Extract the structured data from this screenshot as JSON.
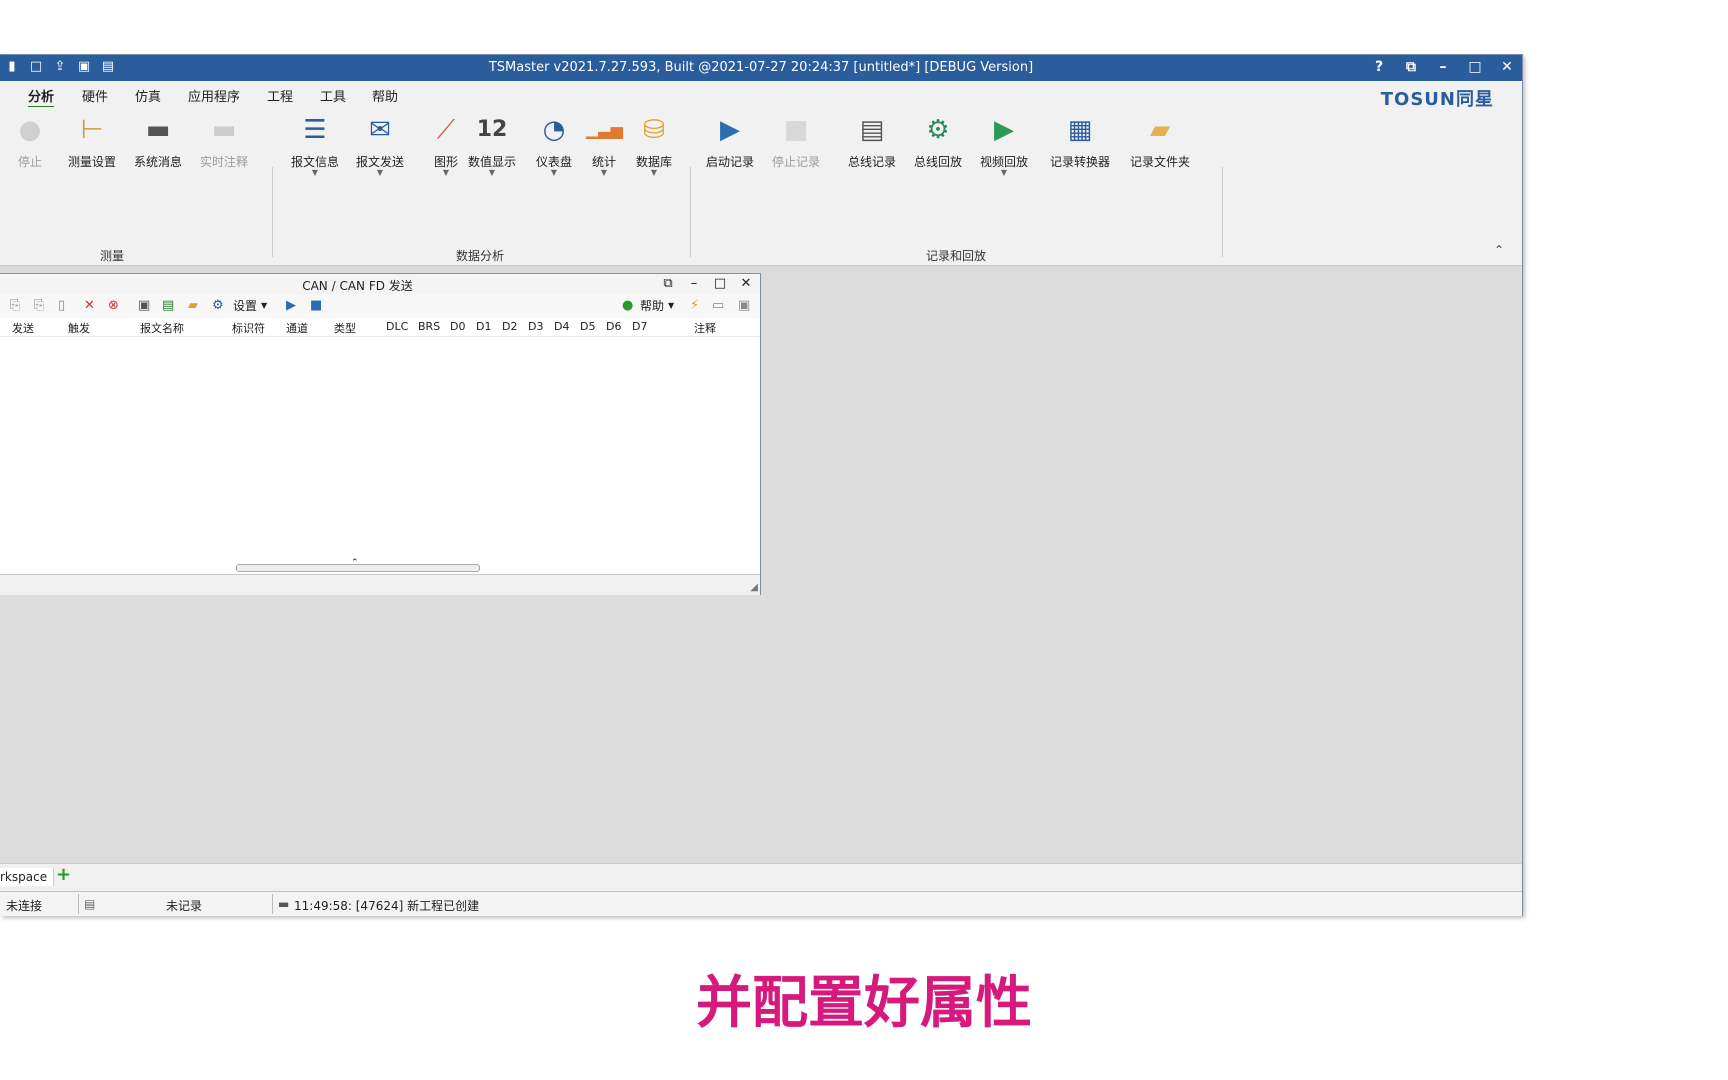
{
  "window": {
    "title": "TSMaster v2021.7.27.593, Built @2021-07-27 20:24:37 [untitled*] [DEBUG Version]",
    "logo": "TOSUN同星",
    "controls": [
      "?",
      "⧉",
      "–",
      "□",
      "✕"
    ]
  },
  "menu": [
    "分析",
    "硬件",
    "仿真",
    "应用程序",
    "工程",
    "工具",
    "帮助"
  ],
  "ribbon": {
    "buttons": [
      {
        "label": "停止",
        "icon": "stop-circle-icon",
        "glyph": "●",
        "color": "#d0d0d0",
        "disabled": true
      },
      {
        "label": "测量设置",
        "icon": "tree-settings-icon",
        "glyph": "⊢",
        "color": "#c8a040"
      },
      {
        "label": "系统消息",
        "icon": "chat-bubble-icon",
        "glyph": "▬",
        "color": "#555555"
      },
      {
        "label": "实时注释",
        "icon": "comment-icon",
        "glyph": "▬",
        "color": "#cccccc",
        "disabled": true
      },
      {
        "label": "报文信息",
        "icon": "list-icon",
        "glyph": "☰",
        "color": "#2a5d9c",
        "dropdown": true
      },
      {
        "label": "报文发送",
        "icon": "send-mail-icon",
        "glyph": "✉",
        "color": "#2a5d9c",
        "dropdown": true
      },
      {
        "label": "图形",
        "icon": "line-graph-icon",
        "glyph": "⟋",
        "color": "#e05a4a",
        "dropdown": true
      },
      {
        "label": "数值显示",
        "icon": "number-display-icon",
        "glyph": "12",
        "color": "#444444",
        "dropdown": true
      },
      {
        "label": "仪表盘",
        "icon": "gauge-icon",
        "glyph": "◔",
        "color": "#2a5d9c",
        "dropdown": true
      },
      {
        "label": "统计",
        "icon": "bar-stats-icon",
        "glyph": "▁▃▅",
        "color": "#e07a30",
        "dropdown": true
      },
      {
        "label": "数据库",
        "icon": "database-icon",
        "glyph": "⛁",
        "color": "#e0a030",
        "dropdown": true
      },
      {
        "label": "启动记录",
        "icon": "play-record-icon",
        "glyph": "▶",
        "color": "#2a6db0"
      },
      {
        "label": "停止记录",
        "icon": "stop-record-icon",
        "glyph": "■",
        "color": "#d8d8d8",
        "disabled": true
      },
      {
        "label": "总线记录",
        "icon": "bus-log-icon",
        "glyph": "▤",
        "color": "#555555"
      },
      {
        "label": "总线回放",
        "icon": "bus-replay-icon",
        "glyph": "⚙",
        "color": "#2a8a5a"
      },
      {
        "label": "视频回放",
        "icon": "video-replay-icon",
        "glyph": "▶",
        "color": "#2a9a5a",
        "dropdown": true
      },
      {
        "label": "记录转换器",
        "icon": "log-converter-icon",
        "glyph": "▦",
        "color": "#2a5d9c"
      },
      {
        "label": "记录文件夹",
        "icon": "folder-icon",
        "glyph": "▰",
        "color": "#e8b050"
      }
    ],
    "groups": [
      "测量",
      "数据分析",
      "记录和回放"
    ]
  },
  "child_window": {
    "title": "CAN / CAN FD 发送",
    "toolbar": {
      "settings_label": "设置",
      "help_label": "帮助"
    },
    "columns": [
      "发送",
      "触发",
      "报文名称",
      "标识符",
      "通道",
      "类型",
      "DLC",
      "BRS",
      "D0",
      "D1",
      "D2",
      "D3",
      "D4",
      "D5",
      "D6",
      "D7",
      "注释"
    ]
  },
  "workspace": {
    "tab_label": "rkspace",
    "add_label": "+"
  },
  "status": {
    "connection": "未连接",
    "record": "未记录",
    "message": "11:49:58: [47624] 新工程已创建"
  },
  "caption": "并配置好属性"
}
